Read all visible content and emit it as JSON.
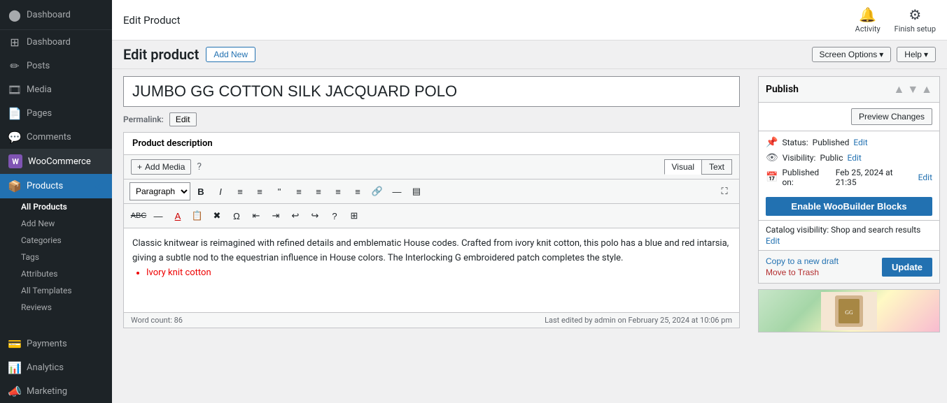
{
  "sidebar": {
    "logo_label": "Dashboard",
    "items": [
      {
        "id": "dashboard",
        "label": "Dashboard",
        "icon": "⊞"
      },
      {
        "id": "posts",
        "label": "Posts",
        "icon": "📝"
      },
      {
        "id": "media",
        "label": "Media",
        "icon": "🖼"
      },
      {
        "id": "pages",
        "label": "Pages",
        "icon": "📄"
      },
      {
        "id": "comments",
        "label": "Comments",
        "icon": "💬"
      },
      {
        "id": "woocommerce",
        "label": "WooCommerce",
        "icon": "W"
      },
      {
        "id": "products",
        "label": "Products",
        "icon": "🛒",
        "active": true
      }
    ],
    "products_subitems": [
      {
        "id": "all-products",
        "label": "All Products",
        "active": true
      },
      {
        "id": "add-new",
        "label": "Add New"
      },
      {
        "id": "categories",
        "label": "Categories"
      },
      {
        "id": "tags",
        "label": "Tags"
      },
      {
        "id": "attributes",
        "label": "Attributes"
      },
      {
        "id": "all-templates",
        "label": "All Templates"
      },
      {
        "id": "reviews",
        "label": "Reviews"
      }
    ],
    "payments_label": "Payments",
    "analytics_label": "Analytics",
    "marketing_label": "Marketing"
  },
  "topbar": {
    "title": "Edit Product",
    "activity_label": "Activity",
    "finish_setup_label": "Finish setup"
  },
  "subheader": {
    "page_title": "Edit product",
    "add_new_label": "Add New",
    "screen_options_label": "Screen Options",
    "help_label": "Help"
  },
  "editor": {
    "product_title": "JUMBO GG COTTON SILK JACQUARD POLO",
    "permalink_label": "Permalink:",
    "permalink_edit_label": "Edit",
    "description_header": "Product description",
    "add_media_label": "Add Media",
    "help_icon": "?",
    "visual_tab": "Visual",
    "text_tab": "Text",
    "formatting": {
      "paragraph_select": "Paragraph",
      "bold": "B",
      "italic": "I",
      "unordered_list": "≡",
      "ordered_list": "≡",
      "blockquote": "❝",
      "align_left": "≡",
      "align_center": "≡",
      "align_right": "≡",
      "align_justify": "≡",
      "link": "🔗",
      "more": "—",
      "fullscreen": "⛶"
    },
    "content": "Classic knitwear is reimagined with refined details and emblematic House codes. Crafted from ivory knit cotton, this polo has a blue and red intarsia, giving a subtle nod to the equestrian influence in House colors. The Interlocking G embroidered patch completes the style.",
    "bullet_item": "Ivory knit cotton",
    "word_count_label": "Word count: 86",
    "last_edited_label": "Last edited by admin on February 25, 2024 at 10:06 pm"
  },
  "publish_panel": {
    "title": "Publish",
    "preview_changes_label": "Preview Changes",
    "status_label": "Status:",
    "status_value": "Published",
    "status_edit": "Edit",
    "visibility_label": "Visibility:",
    "visibility_value": "Public",
    "visibility_edit": "Edit",
    "published_on_label": "Published on:",
    "published_on_value": "Feb 25, 2024 at 21:35",
    "published_on_edit": "Edit",
    "enable_woobuilder_label": "Enable WooBuilder Blocks",
    "catalog_visibility_label": "Catalog visibility:",
    "catalog_visibility_value": "Shop and search results",
    "catalog_visibility_edit": "Edit",
    "copy_draft_label": "Copy to a new draft",
    "move_trash_label": "Move to Trash",
    "update_label": "Update"
  }
}
